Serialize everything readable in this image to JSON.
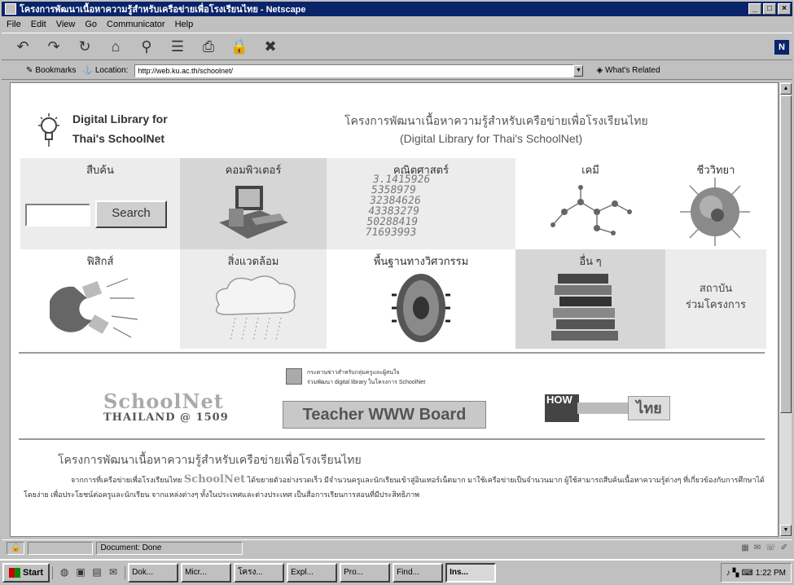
{
  "window": {
    "title": "โครงการพัฒนาเนื้อหาความรู้สำหรับเครือข่ายเพื่อโรงเรียนไทย - Netscape",
    "buttons": [
      "_",
      "□",
      "×"
    ]
  },
  "menu": [
    "File",
    "Edit",
    "View",
    "Go",
    "Communicator",
    "Help"
  ],
  "toolbar": {
    "icons": [
      "back-icon",
      "forward-icon",
      "reload-icon",
      "home-icon",
      "search-icon",
      "guide-icon",
      "print-icon",
      "security-icon",
      "stop-icon"
    ],
    "glyphs": [
      "↶",
      "↷",
      "↻",
      "⌂",
      "⚲",
      "☰",
      "⎙",
      "🔒",
      "✖"
    ],
    "logo": "N"
  },
  "location": {
    "bookmarks_label": "Bookmarks",
    "location_label": "Location:",
    "url": "http://web.ku.ac.th/schoolnet/",
    "related_label": "What's Related"
  },
  "header": {
    "logo_line1": "Digital Library for",
    "logo_line2": "Thai's SchoolNet",
    "title_thai": "โครงการพัฒนาเนื้อหาความรู้สำหรับเครือข่ายเพื่อโรงเรียนไทย",
    "title_en": "(Digital Library for Thai's SchoolNet)"
  },
  "grid": {
    "search_label": "สืบค้น",
    "search_button": "Search",
    "computer": "คอมพิวเตอร์",
    "math": "คณิตศาสตร์",
    "math_digits": "3.1415926\n5358979\n32384626\n43383279\n50288419\n71693993",
    "chemistry": "เคมี",
    "biology": "ชีววิทยา",
    "physics": "ฟิสิกส์",
    "environment": "สิ่งแวดล้อม",
    "engineering": "พื้นฐานทางวิศวกรรม",
    "others": "อื่น ๆ",
    "partners_line1": "สถาบัน",
    "partners_line2": "ร่วมโครงการ"
  },
  "banners": {
    "schoolnet_top": "SchoolNet",
    "schoolnet_bottom": "THAILAND @ 1509",
    "notice_line1": "กระดานข่าวสำหรับกลุ่มครูและผู้สนใจ",
    "notice_line2": "ร่วมพัฒนา digital library ในโครงการ SchoolNet",
    "teacher_board": "Teacher WWW Board",
    "how_label": "HOW",
    "thai_label": "ไทย"
  },
  "body": {
    "section_title": "โครงการพัฒนาเนื้อหาความรู้สำหรับเครือข่ายเพื่อโรงเรียนไทย",
    "para_start": "จากการที่เครือข่ายเพื่อโรงเรียนไทย",
    "para_sn": "SchoolNet",
    "para_rest": "ได้ขยายตัวอย่างรวดเร็ว มีจำนวนครูและนักเรียนเข้าสู่อินเทอร์เน็ตมาก มาใช้เครือข่ายเป็นจำนวนมาก ผู้ใช้สามารถสืบค้นเนื้อหาความรู้ต่างๆ ที่เกี่ยวข้องกับการศึกษาได้โดยง่าย เพื่อประโยชน์ต่อครูและนักเรียน จากแหล่งต่างๆ ทั้งในประเทศและต่างประเทศ เป็นสื่อการเรียนการสอนที่มีประสิทธิภาพ"
  },
  "status": {
    "text": "Document: Done"
  },
  "taskbar": {
    "start": "Start",
    "tasks": [
      "Dok...",
      "Micr...",
      "โครง...",
      "Expl...",
      "Pro...",
      "Find...",
      "Ins..."
    ],
    "clock": "1:22 PM"
  }
}
